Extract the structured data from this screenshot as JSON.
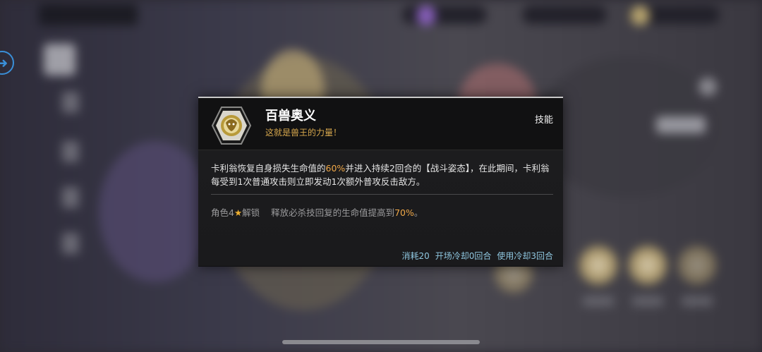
{
  "skill": {
    "name": "百兽奥义",
    "subtitle": "这就是兽王的力量！",
    "type_tag": "技能",
    "desc_part1": "卡利翁恢复自身损失生命值的",
    "desc_value1": "60%",
    "desc_part2": "并进入持续2回合的【战斗姿态】，在此期间，卡利翁每受到1次普通攻击则立即发动1次额外普攻反击敌方。",
    "upgrade_prefix": "角色4",
    "upgrade_star": "★",
    "upgrade_suffix": "解锁",
    "upgrade_text": "释放必杀技回复的生命值提高到",
    "upgrade_value": "70%",
    "upgrade_end": "。",
    "cost": "消耗20",
    "start_cd": "开场冷却0回合",
    "use_cd": "使用冷却3回合"
  },
  "colors": {
    "accent": "#f0a848",
    "footer": "#8fc7e0",
    "subtitle": "#d7a84d"
  },
  "icons": {
    "emblem": "lion-emblem-icon",
    "back": "arrow-right-circle-icon"
  }
}
